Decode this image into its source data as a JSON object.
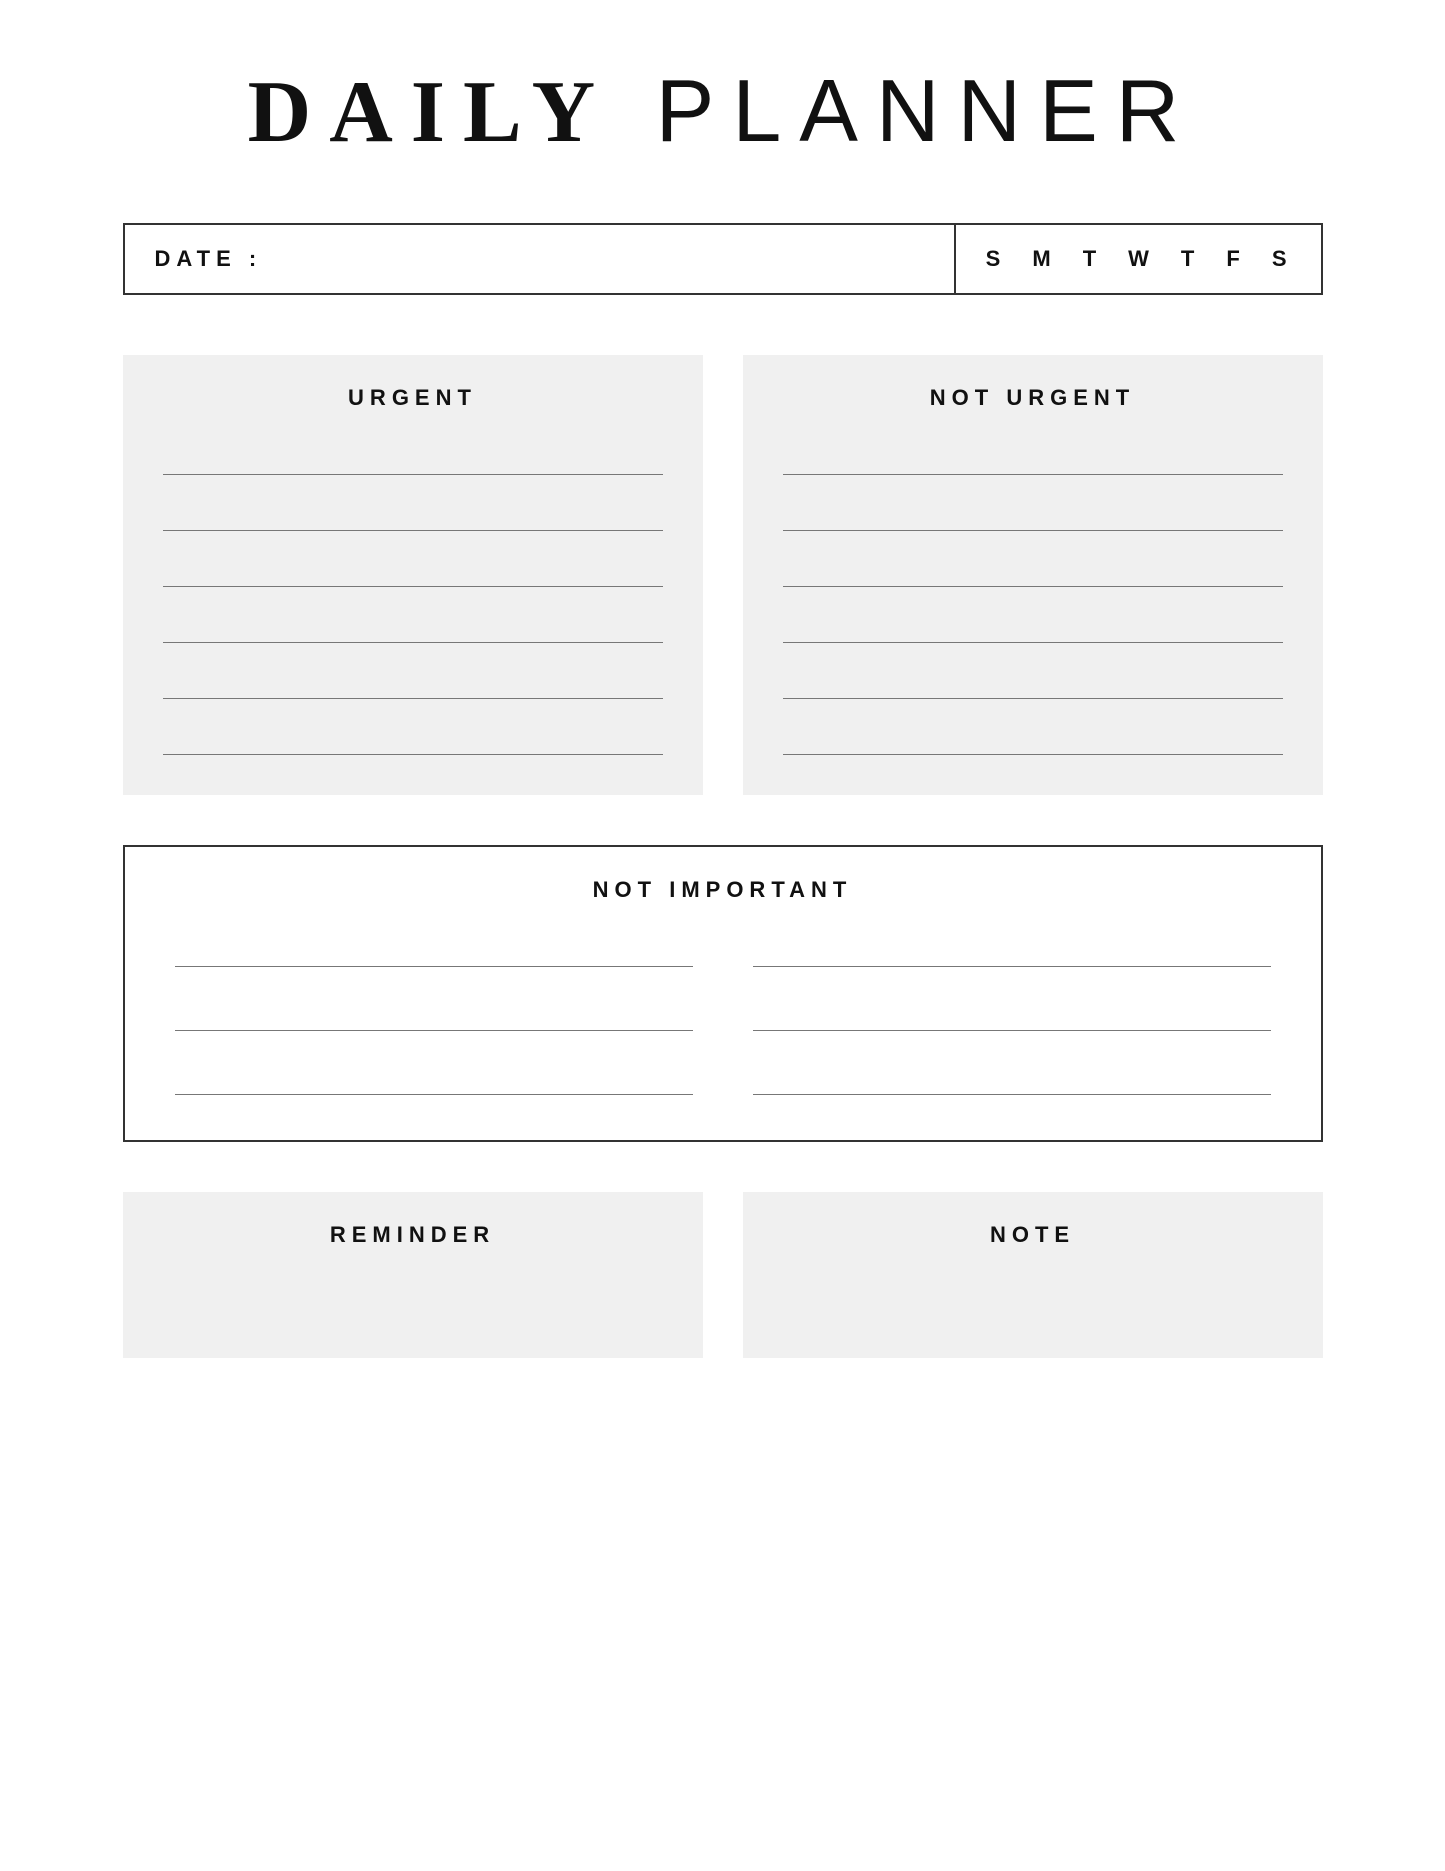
{
  "title": {
    "daily": "DAILY",
    "planner": " PLANNER"
  },
  "date_bar": {
    "label": "DATE :",
    "days": [
      "S",
      "M",
      "T",
      "W",
      "T",
      "F",
      "S"
    ]
  },
  "urgent_box": {
    "title": "URGENT",
    "lines": 6
  },
  "not_urgent_box": {
    "title": "NOT URGENT",
    "lines": 6
  },
  "not_important_box": {
    "title": "NOT IMPORTANT",
    "lines_per_col": 3
  },
  "reminder_box": {
    "title": "REMINDER"
  },
  "note_box": {
    "title": "NOTE"
  }
}
